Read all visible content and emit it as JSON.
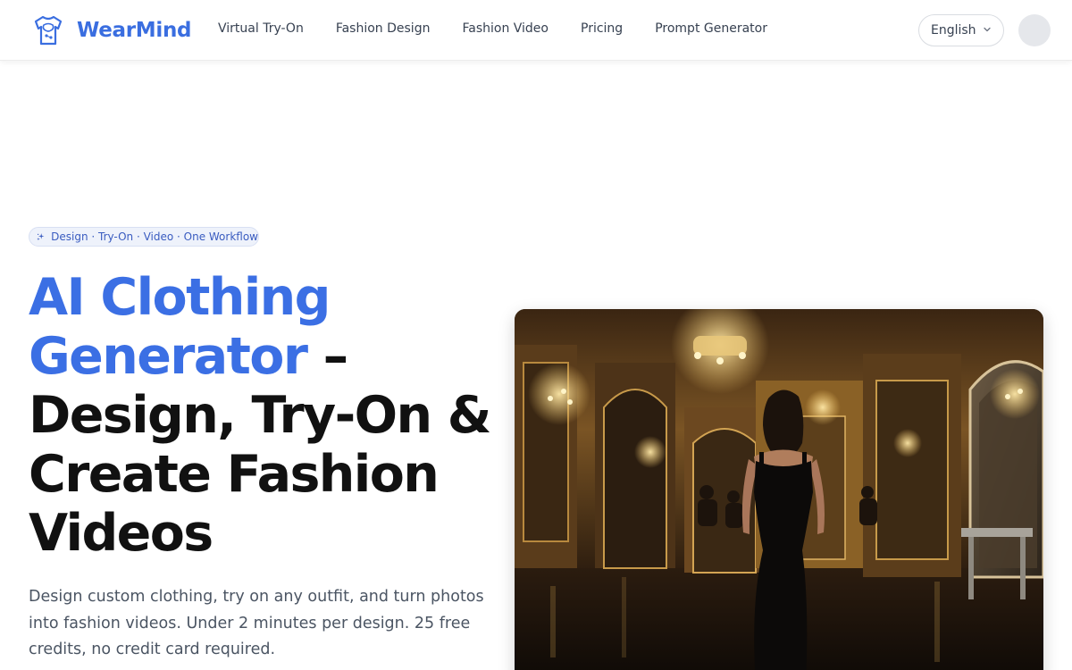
{
  "brand": {
    "name": "WearMind",
    "logo_icon": "shirt-brain-logo-icon"
  },
  "nav": {
    "items": [
      {
        "label": "Virtual Try-On"
      },
      {
        "label": "Fashion Design"
      },
      {
        "label": "Fashion Video"
      },
      {
        "label": "Pricing"
      },
      {
        "label": "Prompt Generator"
      }
    ]
  },
  "language": {
    "selected": "English",
    "icon": "chevron-down-icon"
  },
  "badge": {
    "text": "Design · Try-On · Video · One Workflow",
    "icon": "sparkle-icon"
  },
  "hero": {
    "title_accent": "AI Clothing Generator",
    "title_rest": " – Design, Try-On & Create Fashion Videos",
    "description": "Design custom clothing, try on any outfit, and turn photos into fashion videos. Under 2 minutes per design. 25 free credits, no credit card required.",
    "image_subject": "woman-in-black-dress-walking-in-ornate-hall"
  },
  "colors": {
    "accent": "#3b6fe4",
    "brand": "#3a6ee0",
    "headline": "#111111",
    "badge_bg": "#eef2fb"
  }
}
